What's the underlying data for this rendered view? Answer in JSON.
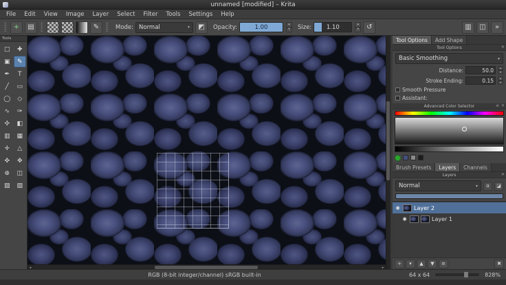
{
  "window": {
    "title": "unnamed [modified] – Krita"
  },
  "menubar": {
    "items": [
      "File",
      "Edit",
      "View",
      "Image",
      "Layer",
      "Select",
      "Filter",
      "Tools",
      "Settings",
      "Help"
    ]
  },
  "toolbar": {
    "mode_label": "Mode:",
    "mode_value": "Normal",
    "opacity_label": "Opacity:",
    "opacity_value": "1.00",
    "size_label": "Size:",
    "size_value": "1.10"
  },
  "toolbox": {
    "header": "Tools",
    "tools": [
      {
        "name": "transform-tool",
        "glyph": "□"
      },
      {
        "name": "move-tool",
        "glyph": "✚"
      },
      {
        "name": "crop-tool",
        "glyph": "▣"
      },
      {
        "name": "freehand-brush-tool",
        "glyph": "✎"
      },
      {
        "name": "calligraphy-tool",
        "glyph": "✒"
      },
      {
        "name": "text-tool",
        "glyph": "T"
      },
      {
        "name": "line-tool",
        "glyph": "╱"
      },
      {
        "name": "rectangle-tool",
        "glyph": "▭"
      },
      {
        "name": "ellipse-tool",
        "glyph": "◯"
      },
      {
        "name": "polygon-tool",
        "glyph": "◇"
      },
      {
        "name": "polyline-tool",
        "glyph": "∿"
      },
      {
        "name": "bezier-curve-tool",
        "glyph": "✑"
      },
      {
        "name": "multibrush-tool",
        "glyph": "✣"
      },
      {
        "name": "fill-tool",
        "glyph": "◧"
      },
      {
        "name": "gradient-tool",
        "glyph": "▥"
      },
      {
        "name": "pattern-tool",
        "glyph": "▦"
      },
      {
        "name": "color-picker-tool",
        "glyph": "✛"
      },
      {
        "name": "assistant-tool",
        "glyph": "△"
      },
      {
        "name": "measure-tool",
        "glyph": "✜"
      },
      {
        "name": "pan-tool",
        "glyph": "✥"
      },
      {
        "name": "zoom-tool",
        "glyph": "⊕"
      },
      {
        "name": "rectangular-select-tool",
        "glyph": "◫"
      },
      {
        "name": "outline-select-tool",
        "glyph": "▧"
      },
      {
        "name": "contiguous-select-tool",
        "glyph": "▨"
      }
    ]
  },
  "tool_options": {
    "tab_tool_options": "Tool Options",
    "tab_add_shape": "Add Shape",
    "dock_title": "Tool Options",
    "smoothing_value": "Basic Smoothing",
    "distance_label": "Distance:",
    "distance_value": "50.0",
    "stroke_ending_label": "Stroke Ending:",
    "stroke_ending_value": "0.15",
    "smooth_pressure_label": "Smooth Pressure",
    "assistant_label": "Assistant:"
  },
  "color_selector": {
    "dock_title": "Advanced Color Selector"
  },
  "layers_dock": {
    "tab_brush_presets": "Brush Presets",
    "tab_layers": "Layers",
    "tab_channels": "Channels",
    "dock_title": "Layers",
    "blend_mode": "Normal",
    "layers": [
      {
        "name": "Layer 2"
      },
      {
        "name": "Layer 1"
      }
    ]
  },
  "statusbar": {
    "color_profile": "RGB (8-bit integer/channel)  sRGB built-in",
    "size_info": "64 x 64",
    "zoom": "828%"
  },
  "icons": {
    "close": "✕",
    "dropdown": "▾",
    "spin_up": "▴",
    "spin_down": "▾",
    "menu": "≡",
    "eye": "◉",
    "add": "+",
    "arrow_up": "▲",
    "arrow_down": "▼",
    "delete": "✖",
    "new_doc": "+",
    "open_doc": "▤",
    "eraser": "◩",
    "reload": "↺",
    "workspace": "▥",
    "mirror": "◫",
    "overflow": "»",
    "alpha": "α",
    "inherit_alpha": "◪",
    "scroll_left": "◂",
    "scroll_right": "▸"
  },
  "colors": {
    "selection_blue": "#507099",
    "slider_blue": "#7fa8d4",
    "canvas_base": "#0d0f17",
    "pebble": "#4a5180",
    "last_color_green": "#2fa52f"
  }
}
